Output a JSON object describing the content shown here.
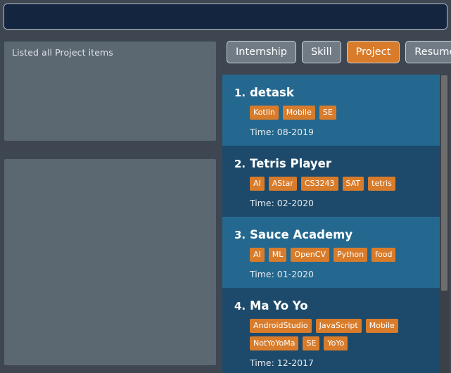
{
  "window": {
    "command_bar_value": "",
    "command_bar_placeholder": ""
  },
  "left": {
    "status_panel": {
      "text": "Listed all Project items"
    },
    "detail_panel": {
      "text": ""
    }
  },
  "tabs": [
    {
      "label": "Internship",
      "active": false
    },
    {
      "label": "Skill",
      "active": false
    },
    {
      "label": "Project",
      "active": true
    },
    {
      "label": "Resume",
      "active": false
    }
  ],
  "cards": [
    {
      "index": "1.",
      "title": "detask",
      "tags": [
        "Kotlin",
        "Mobile",
        "SE"
      ],
      "time": "Time: 08-2019"
    },
    {
      "index": "2.",
      "title": "Tetris Player",
      "tags": [
        "AI",
        "AStar",
        "CS3243",
        "SAT",
        "tetris"
      ],
      "time": "Time: 02-2020"
    },
    {
      "index": "3.",
      "title": "Sauce Academy",
      "tags": [
        "AI",
        "ML",
        "OpenCV",
        "Python",
        "food"
      ],
      "time": "Time: 01-2020"
    },
    {
      "index": "4.",
      "title": "Ma Yo Yo",
      "tags": [
        "AndroidStudio",
        "JavaScript",
        "Mobile",
        "NotYoYoMa",
        "SE",
        "YoYo"
      ],
      "time": "Time: 12-2017"
    }
  ],
  "colors": {
    "app_background": "#3d4651",
    "command_bar": "#14253f",
    "panel": "#5b6771",
    "card": "#25688f",
    "card_alt": "#1d4a6a",
    "accent": "#d87c2b",
    "tab": "#707b85"
  }
}
